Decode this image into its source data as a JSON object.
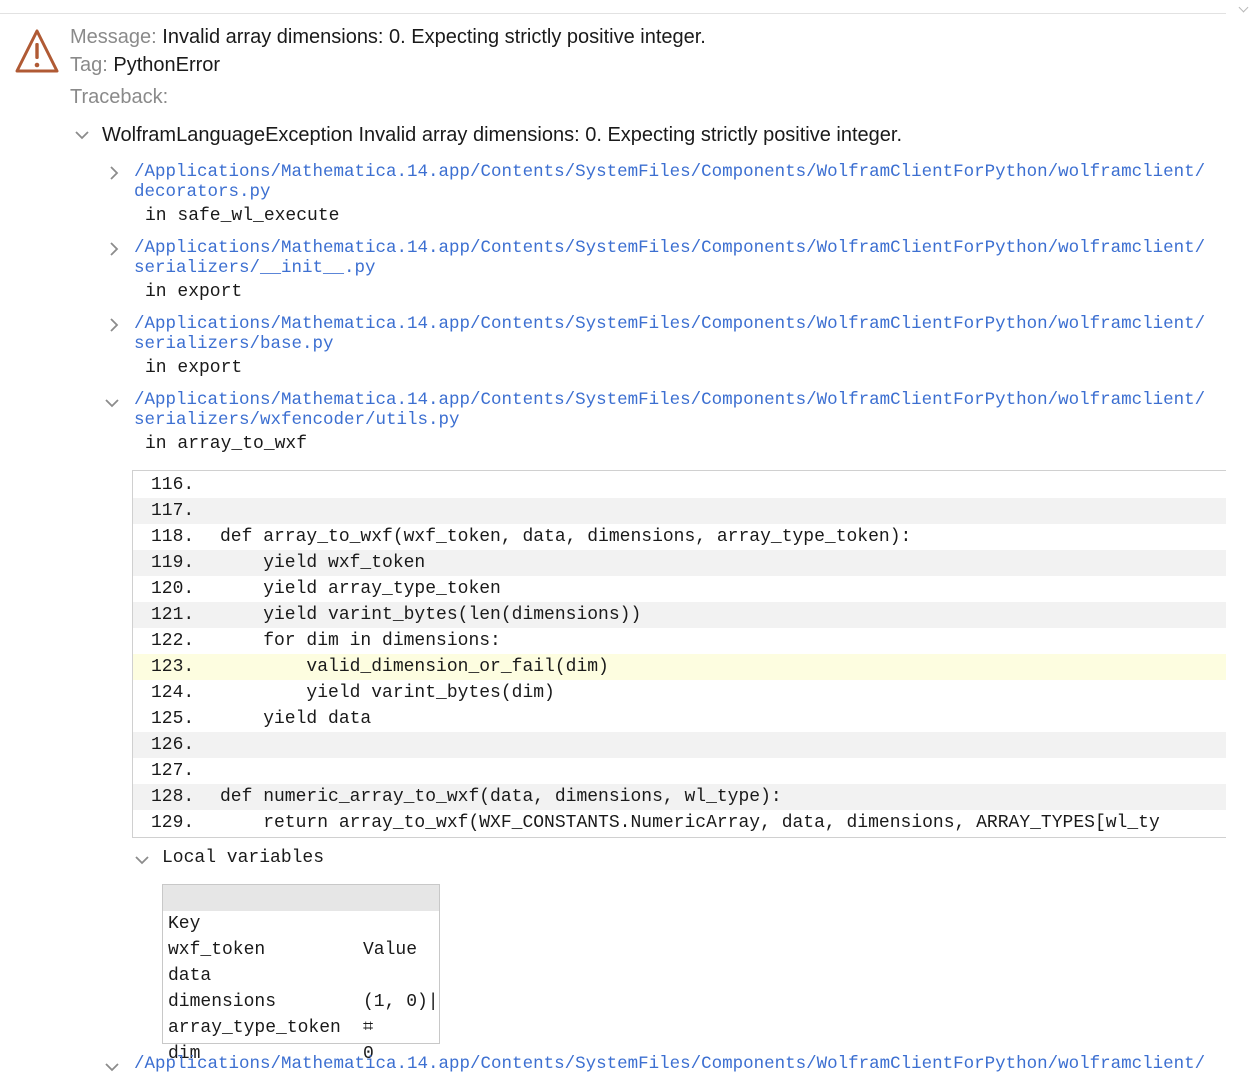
{
  "header": {
    "message_label": "Message:",
    "message_value": "Invalid array dimensions: 0. Expecting strictly positive integer.",
    "tag_label": "Tag:",
    "tag_value": "PythonError",
    "traceback_label": "Traceback:"
  },
  "exception": {
    "title": "WolframLanguageException Invalid array dimensions: 0. Expecting strictly positive integer."
  },
  "frames": [
    {
      "path_line1": "/Applications/Mathematica.14.app/Contents/SystemFiles/Components/WolframClientForPython/wolframclient/",
      "path_line2": "decorators.py",
      "function": "in safe_wl_execute",
      "expanded": false
    },
    {
      "path_line1": "/Applications/Mathematica.14.app/Contents/SystemFiles/Components/WolframClientForPython/wolframclient/",
      "path_line2": "serializers/__init__.py",
      "function": "in export",
      "expanded": false
    },
    {
      "path_line1": "/Applications/Mathematica.14.app/Contents/SystemFiles/Components/WolframClientForPython/wolframclient/",
      "path_line2": "serializers/base.py",
      "function": "in export",
      "expanded": false
    },
    {
      "path_line1": "/Applications/Mathematica.14.app/Contents/SystemFiles/Components/WolframClientForPython/wolframclient/",
      "path_line2": "serializers/wxfencoder/utils.py",
      "function": "in array_to_wxf",
      "expanded": true
    },
    {
      "path_line1": "/Applications/Mathematica.14.app/Contents/SystemFiles/Components/WolframClientForPython/wolframclient/",
      "expanded": true
    }
  ],
  "code": [
    {
      "num": "116.",
      "text": ""
    },
    {
      "num": "117.",
      "text": ""
    },
    {
      "num": "118.",
      "text": "def array_to_wxf(wxf_token, data, dimensions, array_type_token):"
    },
    {
      "num": "119.",
      "text": "    yield wxf_token"
    },
    {
      "num": "120.",
      "text": "    yield array_type_token"
    },
    {
      "num": "121.",
      "text": "    yield varint_bytes(len(dimensions))"
    },
    {
      "num": "122.",
      "text": "    for dim in dimensions:"
    },
    {
      "num": "123.",
      "text": "        valid_dimension_or_fail(dim)",
      "highlight": true
    },
    {
      "num": "124.",
      "text": "        yield varint_bytes(dim)"
    },
    {
      "num": "125.",
      "text": "    yield data"
    },
    {
      "num": "126.",
      "text": ""
    },
    {
      "num": "127.",
      "text": ""
    },
    {
      "num": "128.",
      "text": "def numeric_array_to_wxf(data, dimensions, wl_type):"
    },
    {
      "num": "129.",
      "text": "    return array_to_wxf(WXF_CONSTANTS.NumericArray, data, dimensions, ARRAY_TYPES[wl_ty"
    }
  ],
  "locals": {
    "label": "Local variables",
    "key_header": "Key",
    "value_header": "Value",
    "rows": [
      {
        "key": "wxf_token",
        "value": ""
      },
      {
        "key": "data",
        "value": ""
      },
      {
        "key": "dimensions",
        "value": "(1, 0)|"
      },
      {
        "key": "array_type_token",
        "value": "⌗"
      },
      {
        "key": "dim",
        "value": "0"
      }
    ]
  },
  "colors": {
    "link": "#3c6fd1",
    "warning": "#b05a34",
    "highlight": "#fdfde0",
    "label_gray": "#8a8a8a"
  },
  "icons": {
    "warning": "warning-triangle-icon",
    "collapsed": "chevron-right-icon",
    "expanded": "chevron-down-icon"
  }
}
